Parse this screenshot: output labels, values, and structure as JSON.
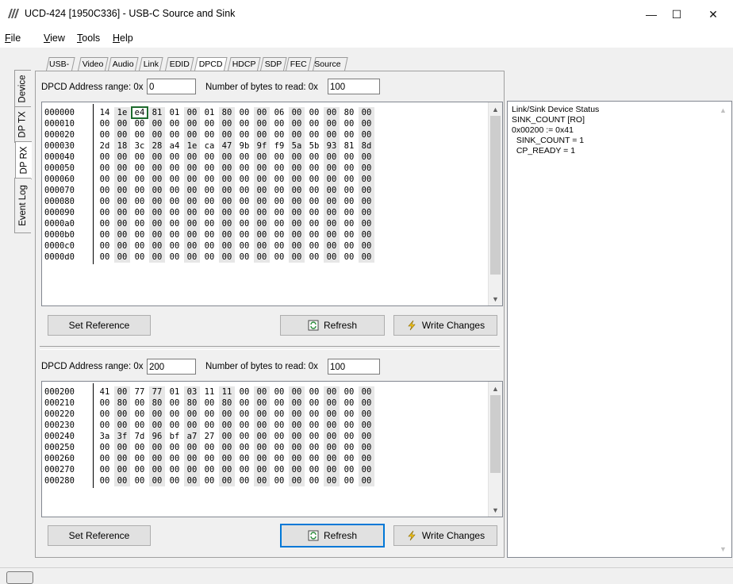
{
  "window": {
    "title": "UCD-424 [1950C336] - USB-C Source and Sink",
    "icon": "app-logo-icon",
    "controls": {
      "minimize": "—",
      "maximize": "☐",
      "close": "✕"
    }
  },
  "menu": [
    {
      "pre": "",
      "ul": "F",
      "post": "ile"
    },
    {
      "pre": "",
      "ul": "V",
      "post": "iew"
    },
    {
      "pre": "",
      "ul": "T",
      "post": "ools"
    },
    {
      "pre": "",
      "ul": "H",
      "post": "elp"
    }
  ],
  "side_tabs": [
    "Device",
    "DP TX",
    "DP RX",
    "Event Log"
  ],
  "top_tabs": [
    "USB-C",
    "Video",
    "Audio",
    "Link",
    "EDID",
    "DPCD",
    "HDCP",
    "SDP",
    "FEC",
    "Source DUT Testing"
  ],
  "active_top_tab": "DPCD",
  "active_side_tab": "DP RX",
  "upper": {
    "range_label": "DPCD Address range: 0x",
    "range_value": "0",
    "bytes_label": "Number of bytes to read: 0x",
    "bytes_value": "100",
    "rows": [
      {
        "addr": "000000",
        "bytes": [
          "14",
          "1e",
          "e4",
          "81",
          "01",
          "00",
          "01",
          "80",
          "00",
          "00",
          "06",
          "00",
          "00",
          "00",
          "80",
          "00"
        ]
      },
      {
        "addr": "000010",
        "bytes": [
          "00",
          "00",
          "00",
          "00",
          "00",
          "00",
          "00",
          "00",
          "00",
          "00",
          "00",
          "00",
          "00",
          "00",
          "00",
          "00"
        ]
      },
      {
        "addr": "000020",
        "bytes": [
          "00",
          "00",
          "00",
          "00",
          "00",
          "00",
          "00",
          "00",
          "00",
          "00",
          "00",
          "00",
          "00",
          "00",
          "00",
          "00"
        ]
      },
      {
        "addr": "000030",
        "bytes": [
          "2d",
          "18",
          "3c",
          "28",
          "a4",
          "1e",
          "ca",
          "47",
          "9b",
          "9f",
          "f9",
          "5a",
          "5b",
          "93",
          "81",
          "8d"
        ]
      },
      {
        "addr": "000040",
        "bytes": [
          "00",
          "00",
          "00",
          "00",
          "00",
          "00",
          "00",
          "00",
          "00",
          "00",
          "00",
          "00",
          "00",
          "00",
          "00",
          "00"
        ]
      },
      {
        "addr": "000050",
        "bytes": [
          "00",
          "00",
          "00",
          "00",
          "00",
          "00",
          "00",
          "00",
          "00",
          "00",
          "00",
          "00",
          "00",
          "00",
          "00",
          "00"
        ]
      },
      {
        "addr": "000060",
        "bytes": [
          "00",
          "00",
          "00",
          "00",
          "00",
          "00",
          "00",
          "00",
          "00",
          "00",
          "00",
          "00",
          "00",
          "00",
          "00",
          "00"
        ]
      },
      {
        "addr": "000070",
        "bytes": [
          "00",
          "00",
          "00",
          "00",
          "00",
          "00",
          "00",
          "00",
          "00",
          "00",
          "00",
          "00",
          "00",
          "00",
          "00",
          "00"
        ]
      },
      {
        "addr": "000080",
        "bytes": [
          "00",
          "00",
          "00",
          "00",
          "00",
          "00",
          "00",
          "00",
          "00",
          "00",
          "00",
          "00",
          "00",
          "00",
          "00",
          "00"
        ]
      },
      {
        "addr": "000090",
        "bytes": [
          "00",
          "00",
          "00",
          "00",
          "00",
          "00",
          "00",
          "00",
          "00",
          "00",
          "00",
          "00",
          "00",
          "00",
          "00",
          "00"
        ]
      },
      {
        "addr": "0000a0",
        "bytes": [
          "00",
          "00",
          "00",
          "00",
          "00",
          "00",
          "00",
          "00",
          "00",
          "00",
          "00",
          "00",
          "00",
          "00",
          "00",
          "00"
        ]
      },
      {
        "addr": "0000b0",
        "bytes": [
          "00",
          "00",
          "00",
          "00",
          "00",
          "00",
          "00",
          "00",
          "00",
          "00",
          "00",
          "00",
          "00",
          "00",
          "00",
          "00"
        ]
      },
      {
        "addr": "0000c0",
        "bytes": [
          "00",
          "00",
          "00",
          "00",
          "00",
          "00",
          "00",
          "00",
          "00",
          "00",
          "00",
          "00",
          "00",
          "00",
          "00",
          "00"
        ]
      },
      {
        "addr": "0000d0",
        "bytes": [
          "00",
          "00",
          "00",
          "00",
          "00",
          "00",
          "00",
          "00",
          "00",
          "00",
          "00",
          "00",
          "00",
          "00",
          "00",
          "00"
        ]
      }
    ],
    "selected_row": 0,
    "selected_col": 2,
    "set_reference_label": "Set Reference",
    "refresh_label": "Refresh",
    "write_label": "Write Changes"
  },
  "lower": {
    "range_label": "DPCD Address range: 0x",
    "range_value": "200",
    "bytes_label": "Number of bytes to read: 0x",
    "bytes_value": "100",
    "rows": [
      {
        "addr": "000200",
        "bytes": [
          "41",
          "00",
          "77",
          "77",
          "01",
          "03",
          "11",
          "11",
          "00",
          "00",
          "00",
          "00",
          "00",
          "00",
          "00",
          "00"
        ]
      },
      {
        "addr": "000210",
        "bytes": [
          "00",
          "80",
          "00",
          "80",
          "00",
          "80",
          "00",
          "80",
          "00",
          "00",
          "00",
          "00",
          "00",
          "00",
          "00",
          "00"
        ]
      },
      {
        "addr": "000220",
        "bytes": [
          "00",
          "00",
          "00",
          "00",
          "00",
          "00",
          "00",
          "00",
          "00",
          "00",
          "00",
          "00",
          "00",
          "00",
          "00",
          "00"
        ]
      },
      {
        "addr": "000230",
        "bytes": [
          "00",
          "00",
          "00",
          "00",
          "00",
          "00",
          "00",
          "00",
          "00",
          "00",
          "00",
          "00",
          "00",
          "00",
          "00",
          "00"
        ]
      },
      {
        "addr": "000240",
        "bytes": [
          "3a",
          "3f",
          "7d",
          "96",
          "bf",
          "a7",
          "27",
          "00",
          "00",
          "00",
          "00",
          "00",
          "00",
          "00",
          "00",
          "00"
        ]
      },
      {
        "addr": "000250",
        "bytes": [
          "00",
          "00",
          "00",
          "00",
          "00",
          "00",
          "00",
          "00",
          "00",
          "00",
          "00",
          "00",
          "00",
          "00",
          "00",
          "00"
        ]
      },
      {
        "addr": "000260",
        "bytes": [
          "00",
          "00",
          "00",
          "00",
          "00",
          "00",
          "00",
          "00",
          "00",
          "00",
          "00",
          "00",
          "00",
          "00",
          "00",
          "00"
        ]
      },
      {
        "addr": "000270",
        "bytes": [
          "00",
          "00",
          "00",
          "00",
          "00",
          "00",
          "00",
          "00",
          "00",
          "00",
          "00",
          "00",
          "00",
          "00",
          "00",
          "00"
        ]
      },
      {
        "addr": "000280",
        "bytes": [
          "00",
          "00",
          "00",
          "00",
          "00",
          "00",
          "00",
          "00",
          "00",
          "00",
          "00",
          "00",
          "00",
          "00",
          "00",
          "00"
        ]
      }
    ],
    "set_reference_label": "Set Reference",
    "refresh_label": "Refresh",
    "write_label": "Write Changes"
  },
  "status": {
    "lines": [
      "Link/Sink Device Status",
      "SINK_COUNT [RO]",
      "0x00200 := 0x41",
      "  SINK_COUNT = 1",
      "  CP_READY = 1"
    ]
  },
  "colors": {
    "selection_border": "#1e6b2e",
    "focus_border": "#0078d7",
    "alt_byte_bg": "#e6e6e6"
  }
}
